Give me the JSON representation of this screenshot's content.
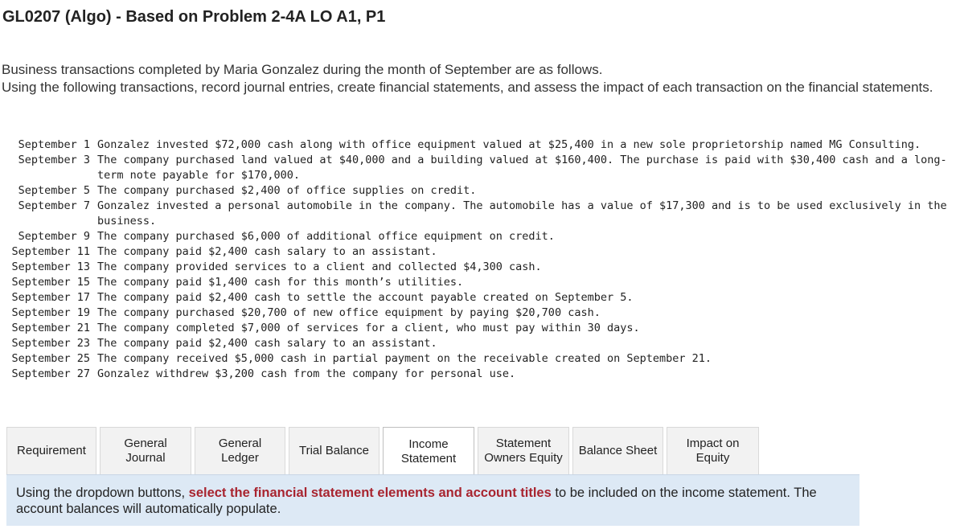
{
  "title": "GL0207 (Algo) - Based on Problem 2-4A LO A1, P1",
  "intro": {
    "line1": "Business transactions completed by Maria Gonzalez during the month of September are as follows.",
    "line2": "Using the following transactions, record journal entries, create financial statements, and assess the impact of each transaction on the financial statements."
  },
  "transactions": [
    {
      "date": "September 1",
      "text": "Gonzalez invested $72,000 cash along with office equipment valued at $25,400 in a new sole proprietorship named MG Consulting."
    },
    {
      "date": "September 3",
      "text": "The company purchased land valued at $40,000 and a building valued at $160,400. The purchase is paid with $30,400 cash and a long-term note payable for $170,000."
    },
    {
      "date": "September 5",
      "text": "The company purchased $2,400 of office supplies on credit."
    },
    {
      "date": "September 7",
      "text": "Gonzalez invested a personal automobile in the company. The automobile has a value of $17,300 and is to be used exclusively in the business."
    },
    {
      "date": "September 9",
      "text": "The company purchased $6,000 of additional office equipment on credit."
    },
    {
      "date": "September 11",
      "text": "The company paid $2,400 cash salary to an assistant."
    },
    {
      "date": "September 13",
      "text": "The company provided services to a client and collected $4,300 cash."
    },
    {
      "date": "September 15",
      "text": "The company paid $1,400 cash for this month’s utilities."
    },
    {
      "date": "September 17",
      "text": "The company paid $2,400 cash to settle the account payable created on September 5."
    },
    {
      "date": "September 19",
      "text": "The company purchased $20,700 of new office equipment by paying $20,700 cash."
    },
    {
      "date": "September 21",
      "text": "The company completed $7,000 of services for a client, who must pay within 30 days."
    },
    {
      "date": "September 23",
      "text": "The company paid $2,400 cash salary to an assistant."
    },
    {
      "date": "September 25",
      "text": "The company received $5,000 cash in partial payment on the receivable created on September 21."
    },
    {
      "date": "September 27",
      "text": "Gonzalez withdrew $3,200 cash from the company for personal use."
    }
  ],
  "tabs": {
    "requirement": "Requirement",
    "general_journal_1": "General",
    "general_journal_2": "Journal",
    "general_ledger_1": "General",
    "general_ledger_2": "Ledger",
    "trial_balance": "Trial Balance",
    "income_statement_1": "Income",
    "income_statement_2": "Statement",
    "owners_equity_1": "Statement",
    "owners_equity_2": "Owners Equity",
    "balance_sheet": "Balance Sheet",
    "impact_1": "Impact on",
    "impact_2": "Equity",
    "active": "Income Statement"
  },
  "instruction": {
    "pre": "Using the dropdown buttons, ",
    "highlight": "select the financial statement elements and account titles",
    "post": " to be included on the income statement.  The account balances will automatically populate."
  },
  "colors": {
    "highlight": "#a8242f",
    "panel_bg": "#dde9f5",
    "tab_bg": "#f2f2f2"
  }
}
